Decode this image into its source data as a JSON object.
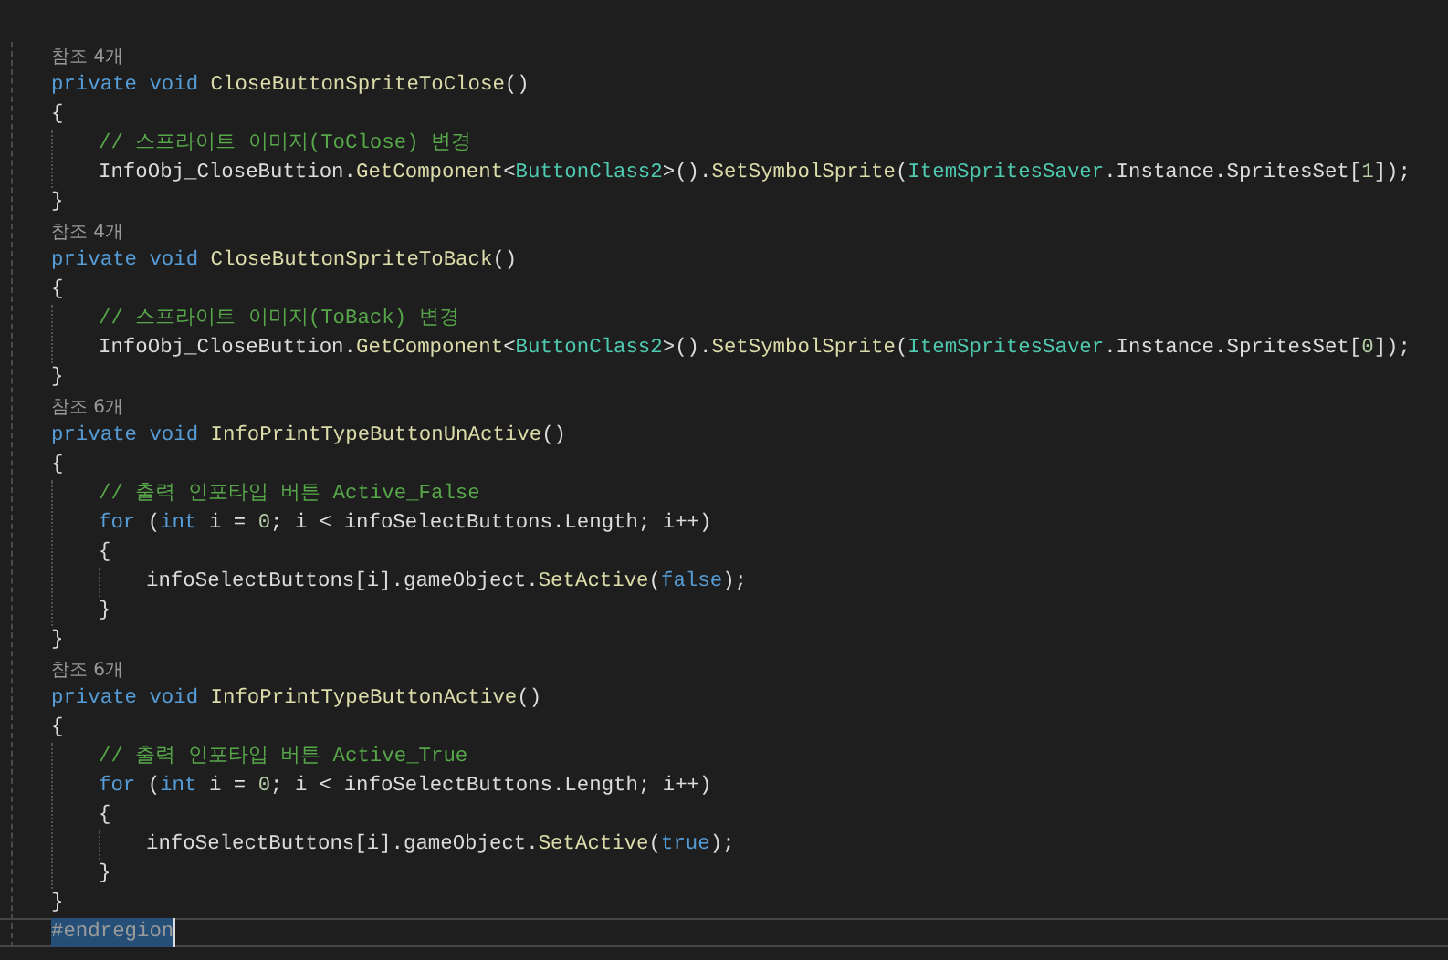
{
  "editor": {
    "lines": [
      {
        "kind": "codelens",
        "text": "참조 4개"
      },
      {
        "kind": "code",
        "tokens": [
          {
            "kind": "keyword",
            "text": "private void "
          },
          {
            "kind": "method",
            "text": "CloseButtonSpriteToClose"
          },
          {
            "kind": "plain",
            "text": "()"
          }
        ]
      },
      {
        "kind": "code",
        "tokens": [
          {
            "kind": "plain",
            "text": "{"
          }
        ]
      },
      {
        "kind": "block",
        "children": [
          {
            "kind": "code",
            "tokens": [
              {
                "kind": "comment",
                "text": "// 스프라이트 이미지(ToClose) 변경"
              }
            ]
          },
          {
            "kind": "code",
            "tokens": [
              {
                "kind": "plain",
                "text": "InfoObj_CloseButtion."
              },
              {
                "kind": "method",
                "text": "GetComponent"
              },
              {
                "kind": "plain",
                "text": "<"
              },
              {
                "kind": "class",
                "text": "ButtonClass2"
              },
              {
                "kind": "plain",
                "text": ">()."
              },
              {
                "kind": "method",
                "text": "SetSymbolSprite"
              },
              {
                "kind": "plain",
                "text": "("
              },
              {
                "kind": "class",
                "text": "ItemSpritesSaver"
              },
              {
                "kind": "plain",
                "text": ".Instance.SpritesSet["
              },
              {
                "kind": "number",
                "text": "1"
              },
              {
                "kind": "plain",
                "text": "]);"
              }
            ]
          }
        ]
      },
      {
        "kind": "code",
        "tokens": [
          {
            "kind": "plain",
            "text": "}"
          }
        ]
      },
      {
        "kind": "codelens",
        "text": "참조 4개"
      },
      {
        "kind": "code",
        "tokens": [
          {
            "kind": "keyword",
            "text": "private void "
          },
          {
            "kind": "method",
            "text": "CloseButtonSpriteToBack"
          },
          {
            "kind": "plain",
            "text": "()"
          }
        ]
      },
      {
        "kind": "code",
        "tokens": [
          {
            "kind": "plain",
            "text": "{"
          }
        ]
      },
      {
        "kind": "block",
        "children": [
          {
            "kind": "code",
            "tokens": [
              {
                "kind": "comment",
                "text": "// 스프라이트 이미지(ToBack) 변경"
              }
            ]
          },
          {
            "kind": "code",
            "tokens": [
              {
                "kind": "plain",
                "text": "InfoObj_CloseButtion."
              },
              {
                "kind": "method",
                "text": "GetComponent"
              },
              {
                "kind": "plain",
                "text": "<"
              },
              {
                "kind": "class",
                "text": "ButtonClass2"
              },
              {
                "kind": "plain",
                "text": ">()."
              },
              {
                "kind": "method",
                "text": "SetSymbolSprite"
              },
              {
                "kind": "plain",
                "text": "("
              },
              {
                "kind": "class",
                "text": "ItemSpritesSaver"
              },
              {
                "kind": "plain",
                "text": ".Instance.SpritesSet["
              },
              {
                "kind": "number",
                "text": "0"
              },
              {
                "kind": "plain",
                "text": "]);"
              }
            ]
          }
        ]
      },
      {
        "kind": "code",
        "tokens": [
          {
            "kind": "plain",
            "text": "}"
          }
        ]
      },
      {
        "kind": "codelens",
        "text": "참조 6개"
      },
      {
        "kind": "code",
        "tokens": [
          {
            "kind": "keyword",
            "text": "private void "
          },
          {
            "kind": "method",
            "text": "InfoPrintTypeButtonUnActive"
          },
          {
            "kind": "plain",
            "text": "()"
          }
        ]
      },
      {
        "kind": "code",
        "tokens": [
          {
            "kind": "plain",
            "text": "{"
          }
        ]
      },
      {
        "kind": "block",
        "children": [
          {
            "kind": "code",
            "tokens": [
              {
                "kind": "comment",
                "text": "// 출력 인포타입 버튼 Active_False"
              }
            ]
          },
          {
            "kind": "code",
            "tokens": [
              {
                "kind": "keyword",
                "text": "for"
              },
              {
                "kind": "plain",
                "text": " ("
              },
              {
                "kind": "keyword",
                "text": "int"
              },
              {
                "kind": "plain",
                "text": " i = "
              },
              {
                "kind": "number",
                "text": "0"
              },
              {
                "kind": "plain",
                "text": "; i < infoSelectButtons.Length; i++)"
              }
            ]
          },
          {
            "kind": "code",
            "tokens": [
              {
                "kind": "plain",
                "text": "{"
              }
            ]
          },
          {
            "kind": "block",
            "children": [
              {
                "kind": "code",
                "tokens": [
                  {
                    "kind": "plain",
                    "text": "infoSelectButtons[i].gameObject."
                  },
                  {
                    "kind": "method",
                    "text": "SetActive"
                  },
                  {
                    "kind": "plain",
                    "text": "("
                  },
                  {
                    "kind": "keyword",
                    "text": "false"
                  },
                  {
                    "kind": "plain",
                    "text": ");"
                  }
                ]
              }
            ]
          },
          {
            "kind": "code",
            "tokens": [
              {
                "kind": "plain",
                "text": "}"
              }
            ]
          }
        ]
      },
      {
        "kind": "code",
        "tokens": [
          {
            "kind": "plain",
            "text": "}"
          }
        ]
      },
      {
        "kind": "codelens",
        "text": "참조 6개"
      },
      {
        "kind": "code",
        "tokens": [
          {
            "kind": "keyword",
            "text": "private void "
          },
          {
            "kind": "method",
            "text": "InfoPrintTypeButtonActive"
          },
          {
            "kind": "plain",
            "text": "()"
          }
        ]
      },
      {
        "kind": "code",
        "tokens": [
          {
            "kind": "plain",
            "text": "{"
          }
        ]
      },
      {
        "kind": "block",
        "children": [
          {
            "kind": "code",
            "tokens": [
              {
                "kind": "comment",
                "text": "// 출력 인포타입 버튼 Active_True"
              }
            ]
          },
          {
            "kind": "code",
            "tokens": [
              {
                "kind": "keyword",
                "text": "for"
              },
              {
                "kind": "plain",
                "text": " ("
              },
              {
                "kind": "keyword",
                "text": "int"
              },
              {
                "kind": "plain",
                "text": " i = "
              },
              {
                "kind": "number",
                "text": "0"
              },
              {
                "kind": "plain",
                "text": "; i < infoSelectButtons.Length; i++)"
              }
            ]
          },
          {
            "kind": "code",
            "tokens": [
              {
                "kind": "plain",
                "text": "{"
              }
            ]
          },
          {
            "kind": "block",
            "children": [
              {
                "kind": "code",
                "tokens": [
                  {
                    "kind": "plain",
                    "text": "infoSelectButtons[i].gameObject."
                  },
                  {
                    "kind": "method",
                    "text": "SetActive"
                  },
                  {
                    "kind": "plain",
                    "text": "("
                  },
                  {
                    "kind": "keyword",
                    "text": "true"
                  },
                  {
                    "kind": "plain",
                    "text": ");"
                  }
                ]
              }
            ]
          },
          {
            "kind": "code",
            "tokens": [
              {
                "kind": "plain",
                "text": "}"
              }
            ]
          }
        ]
      },
      {
        "kind": "code",
        "tokens": [
          {
            "kind": "plain",
            "text": "}"
          }
        ]
      },
      {
        "kind": "code",
        "current": true,
        "tokens": [
          {
            "kind": "directive",
            "text": "#endregion",
            "highlighted": true
          }
        ]
      }
    ]
  }
}
